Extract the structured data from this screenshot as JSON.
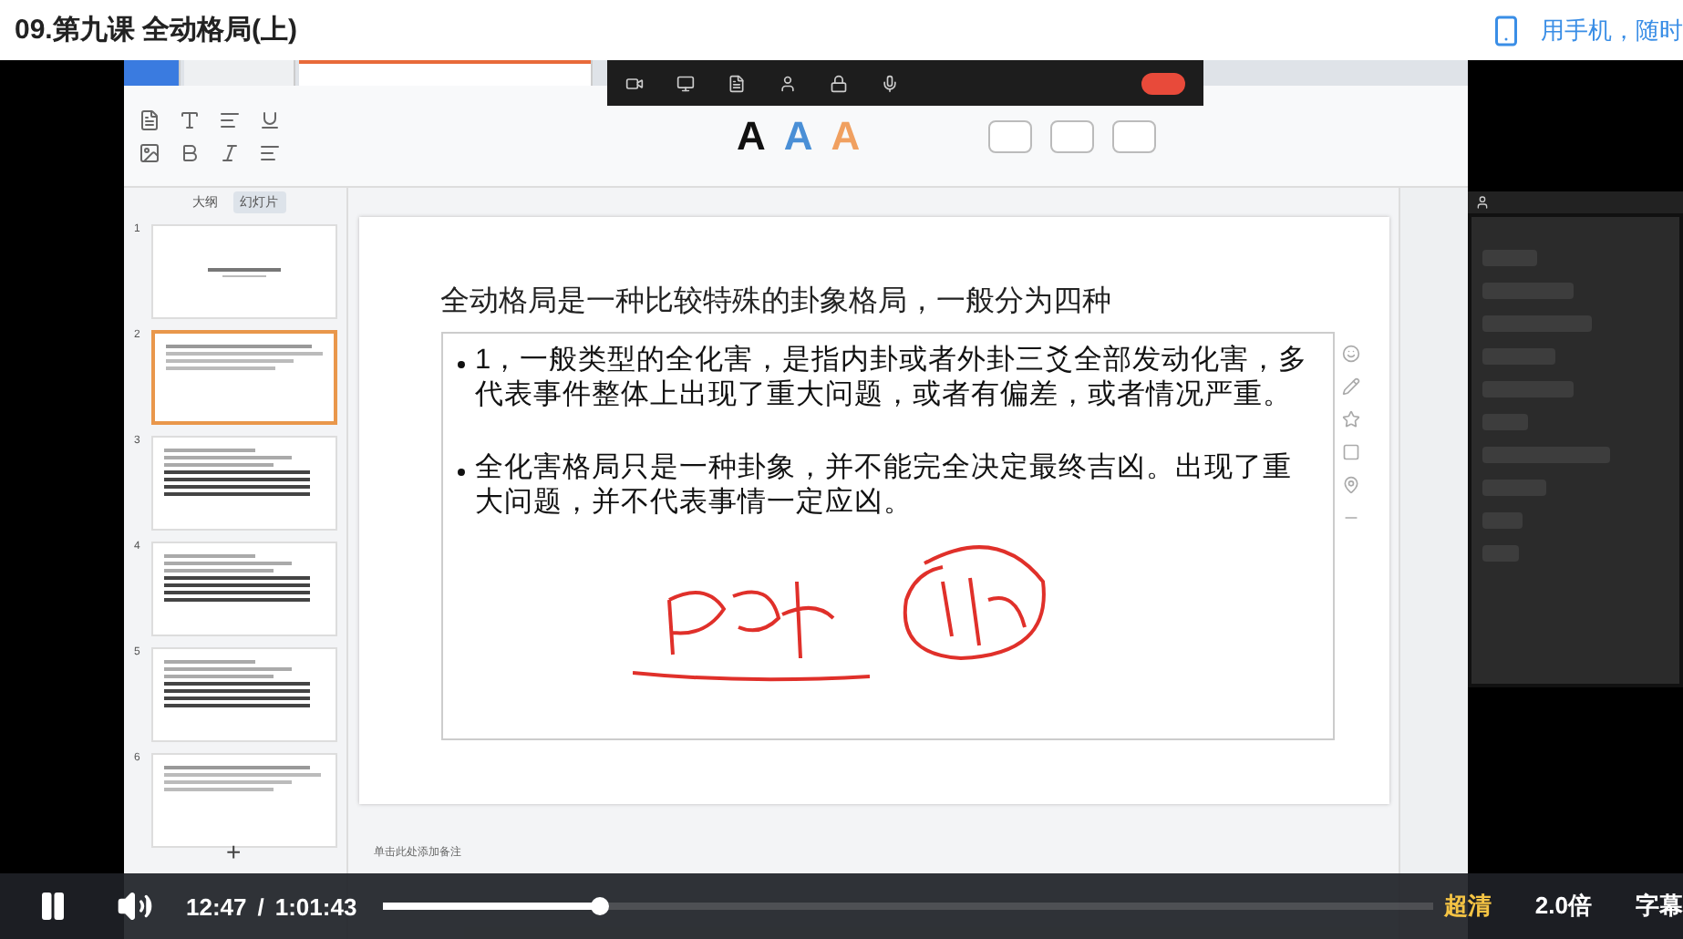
{
  "page_title": "09.第九课 全动格局(上)",
  "mobile_link": "用手机，随时",
  "app": {
    "tabs": [
      {
        "kind": "home",
        "selected": false
      },
      {
        "kind": "docer",
        "selected": false
      },
      {
        "kind": "file",
        "selected": true
      }
    ],
    "text_styles": [
      {
        "label": "A",
        "color": "#111111"
      },
      {
        "label": "A",
        "color": "#4a8fd6"
      },
      {
        "label": "A",
        "color": "#f0a060"
      }
    ],
    "pane_tabs": [
      {
        "label": "大纲",
        "selected": false
      },
      {
        "label": "幻灯片",
        "selected": true
      }
    ],
    "thumbnails": [
      {
        "number": "1",
        "selected": false,
        "kind": "title"
      },
      {
        "number": "2",
        "selected": true,
        "kind": "text"
      },
      {
        "number": "3",
        "selected": false,
        "kind": "table"
      },
      {
        "number": "4",
        "selected": false,
        "kind": "table"
      },
      {
        "number": "5",
        "selected": false,
        "kind": "table"
      },
      {
        "number": "6",
        "selected": false,
        "kind": "text"
      }
    ],
    "slide": {
      "heading": "全动格局是一种比较特殊的卦象格局，一般分为四种",
      "bullets": [
        "1，一般类型的全化害，是指内卦或者外卦三爻全部发动化害，多代表事件整体上出现了重大问题，或者有偏差，或者情况严重。",
        "全化害格局只是一种卦象，并不能完全决定最终吉凶。出现了重大问题，并不代表事情一定应凶。"
      ]
    },
    "notes_placeholder": "单击此处添加备注",
    "add_slide": "+"
  },
  "player": {
    "playing": true,
    "current_time": "12:47",
    "separator": "/",
    "duration": "1:01:43",
    "level": 0.207,
    "options": [
      {
        "label": "超清",
        "selected": true
      },
      {
        "label": "2.0倍",
        "selected": false
      },
      {
        "label": "字幕",
        "selected": false
      }
    ]
  }
}
